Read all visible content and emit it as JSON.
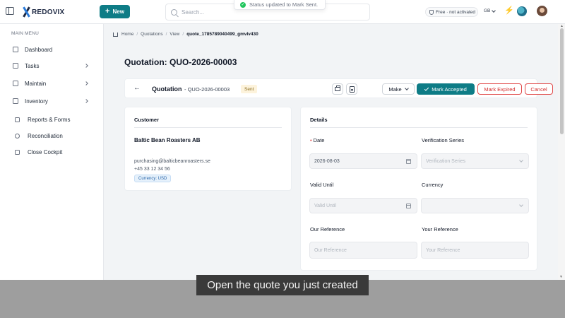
{
  "header": {
    "logo_text": "REDOVIX",
    "new_button": "New",
    "search_placeholder": "Search...",
    "toast": "Status updated to Mark Sent.",
    "plan_badge": "Free · not activated",
    "language": "GB"
  },
  "sidebar": {
    "menu_title": "MAIN MENU",
    "items": [
      {
        "label": "Dashboard"
      },
      {
        "label": "Tasks"
      },
      {
        "label": "Maintain"
      },
      {
        "label": "Inventory"
      },
      {
        "label": "Reports & Forms"
      },
      {
        "label": "Reconciliation"
      },
      {
        "label": "Close Cockpit"
      }
    ]
  },
  "breadcrumb": {
    "home": "Home",
    "quotations": "Quotations",
    "view": "View",
    "current": "quote_1785789040499_gmvlv430"
  },
  "page": {
    "title": "Quotation: QUO-2026-00003"
  },
  "docbar": {
    "type": "Quotation",
    "number": "- QUO-2026-00003",
    "status": "Sent",
    "make": "Make",
    "mark_accepted": "Mark Accepted",
    "mark_expired": "Mark Expired",
    "cancel": "Cancel"
  },
  "customer": {
    "title": "Customer",
    "name": "Baltic Bean Roasters AB",
    "email": "purchasing@balticbeanroasters.se",
    "phone": "+45 33 12 34 56",
    "currency": "Currency: USD"
  },
  "details": {
    "title": "Details",
    "date_label": "Date",
    "date_value": "2026-08-03",
    "verification_label": "Verification Series",
    "verification_placeholder": "Verification Series",
    "valid_until_label": "Valid Until",
    "valid_until_placeholder": "Valid Until",
    "currency_label": "Currency",
    "our_ref_label": "Our Reference",
    "our_ref_placeholder": "Our Reference",
    "your_ref_label": "Your Reference",
    "your_ref_placeholder": "Your Reference"
  },
  "caption": "Open the quote you just created",
  "colors": {
    "accent": "#0e7c86",
    "danger": "#d32f2f",
    "status_sent_bg": "#fdf3dc"
  }
}
